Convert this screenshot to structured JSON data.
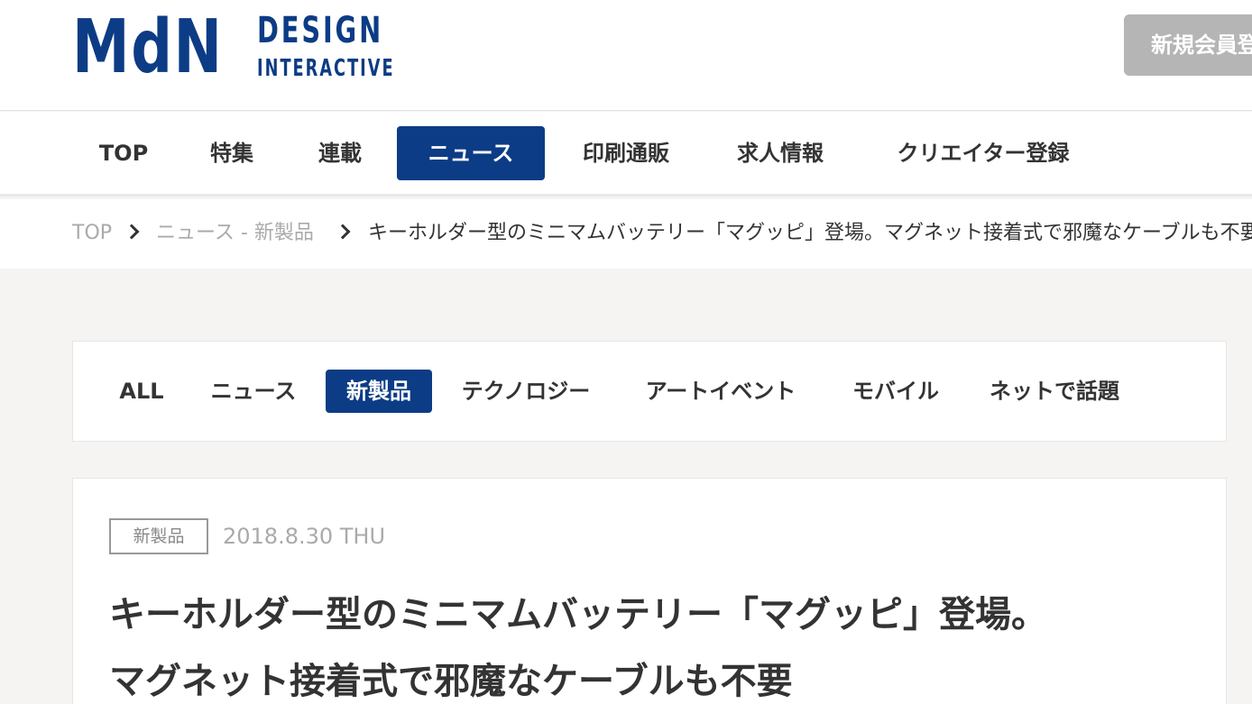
{
  "header": {
    "logo_mdn": "MdN",
    "logo_design": "DESIGN",
    "logo_interactive": "INTERACTIVE",
    "register_label": "新規会員登録"
  },
  "gnav": {
    "items": [
      {
        "label": "TOP"
      },
      {
        "label": "特集"
      },
      {
        "label": "連載"
      },
      {
        "label": "ニュース",
        "active": true
      },
      {
        "label": "印刷通販"
      },
      {
        "label": "求人情報"
      },
      {
        "label": "クリエイター登録"
      }
    ]
  },
  "breadcrumb": {
    "home": "TOP",
    "category": "ニュース - 新製品",
    "current": "キーホルダー型のミニマムバッテリー「マグッピ」登場。マグネット接着式で邪魔なケーブルも不要"
  },
  "categories": {
    "items": [
      {
        "label": "ALL"
      },
      {
        "label": "ニュース"
      },
      {
        "label": "新製品",
        "active": true
      },
      {
        "label": "テクノロジー"
      },
      {
        "label": "アートイベント"
      },
      {
        "label": "モバイル"
      },
      {
        "label": "ネットで話題"
      }
    ]
  },
  "article": {
    "tag": "新製品",
    "date": "2018.8.30 THU",
    "title_line1": "キーホルダー型のミニマムバッテリー「マグッピ」登場。",
    "title_line2": "マグネット接着式で邪魔なケーブルも不要"
  },
  "colors": {
    "brand": "#0c3c85",
    "page_bg": "#f5f4f2",
    "register_bg": "#b5b5b5"
  }
}
